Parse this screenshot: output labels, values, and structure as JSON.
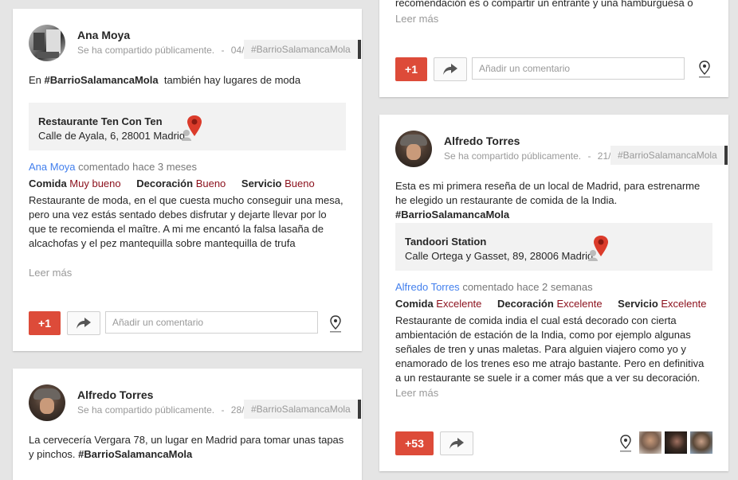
{
  "shared_labels": {
    "plus_one": "+1",
    "comment_placeholder": "Añadir un comentario",
    "read_more": "Leer más",
    "rating_labels": [
      "Comida",
      "Decoración",
      "Servicio"
    ]
  },
  "top_right_card": {
    "text_partial": "recomendación es o compartir un entrante y una hamburguesa o",
    "read_more": "Leer más",
    "plus_label": "+1"
  },
  "post_ana": {
    "author": "Ana Moya",
    "visibility": "Se ha compartido públicamente.",
    "separator": "-",
    "date": "04/",
    "hashtag": "#BarrioSalamancaMola",
    "text_prefix": "En",
    "text_hashtag": "#BarrioSalamancaMola",
    "text_suffix": "también hay lugares de moda",
    "place_name": "Restaurante Ten Con Ten",
    "place_address": "Calle de Ayala, 6, 28001 Madrid",
    "review_author": "Ana Moya",
    "review_meta": "comentado hace 3 meses",
    "ratings": [
      {
        "label": "Comida",
        "value": "Muy bueno"
      },
      {
        "label": "Decoración",
        "value": "Bueno"
      },
      {
        "label": "Servicio",
        "value": "Bueno"
      }
    ],
    "review_text": "Restaurante de moda, en el que cuesta mucho conseguir una mesa, pero una vez estás sentado debes disfrutar y dejarte llevar por lo que te recomienda el maître. A mi me encantó la falsa lasaña de alcachofas y el pez mantequilla sobre mantequilla de trufa",
    "read_more": "Leer más",
    "plus_label": "+1"
  },
  "post_alfredo_1": {
    "author": "Alfredo Torres",
    "visibility": "Se ha compartido públicamente.",
    "separator": "-",
    "date": "21/",
    "hashtag": "#BarrioSalamancaMola",
    "text": "Esta es mi primera reseña de un local de Madrid, para estrenarme he elegido un restaurante de comida de la India.",
    "text_hashtag": "#BarrioSalamancaMola",
    "place_name": "Tandoori Station",
    "place_address": "Calle Ortega y Gasset, 89, 28006 Madrid",
    "review_author": "Alfredo Torres",
    "review_meta": "comentado hace 2 semanas",
    "ratings": [
      {
        "label": "Comida",
        "value": "Excelente"
      },
      {
        "label": "Decoración",
        "value": "Excelente"
      },
      {
        "label": "Servicio",
        "value": "Excelente"
      }
    ],
    "review_text": "Restaurante de comida india el cual está decorado con cierta ambientación de estación de la India, como por ejemplo algunas señales de tren y unas maletas. Para alguien viajero como yo y enamorado de los trenes eso me atrajo bastante. Pero en definitiva a un restaurante se suele ir a comer más que a ver su decoración. Así",
    "read_more": "Leer más",
    "plus_label": "+53"
  },
  "post_alfredo_2": {
    "author": "Alfredo Torres",
    "visibility": "Se ha compartido públicamente.",
    "separator": "-",
    "date": "28/",
    "hashtag": "#BarrioSalamancaMola",
    "text": "La cervecería Vergara 78, un lugar en Madrid para tomar unas tapas y pinchos.",
    "text_hashtag": "#BarrioSalamancaMola"
  },
  "colors": {
    "plus_button": "#dd4b39",
    "rating_value": "#8b0f1b",
    "link_blue": "#427fed",
    "pin_red": "#db3b2b",
    "background": "#e5e5e5"
  },
  "icons": {
    "share": "share-arrow-icon",
    "location": "location-pin-icon",
    "map_pin": "map-marker-icon"
  }
}
